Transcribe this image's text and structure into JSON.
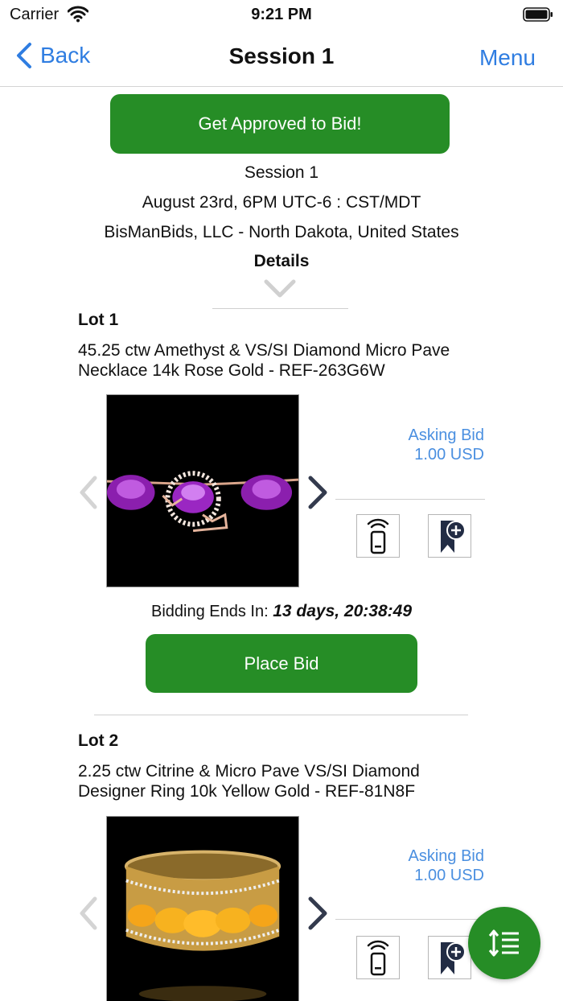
{
  "status_bar": {
    "carrier": "Carrier",
    "time": "9:21 PM"
  },
  "nav": {
    "back_label": "Back",
    "title": "Session 1",
    "menu_label": "Menu"
  },
  "approve_button": "Get Approved to Bid!",
  "session": {
    "name": "Session 1",
    "date": "August 23rd, 6PM UTC-6 : CST/MDT",
    "location": "BisManBids, LLC - North Dakota, United States",
    "details_label": "Details"
  },
  "lots": [
    {
      "title": "Lot 1",
      "description_line1": "45.25 ctw Amethyst & VS/SI Diamond Micro Pave",
      "description_line2": "Necklace 14k Rose Gold - REF-263G6W",
      "asking_label": "Asking Bid",
      "asking_value": "1.00 USD",
      "ends_label": "Bidding Ends In:",
      "ends_value": "13 days, 20:38:49",
      "place_bid_label": "Place Bid"
    },
    {
      "title": "Lot 2",
      "description_line1": "2.25 ctw Citrine & Micro Pave VS/SI Diamond",
      "description_line2": "Designer Ring 10k Yellow Gold - REF-81N8F",
      "asking_label": "Asking Bid",
      "asking_value": "1.00 USD"
    }
  ],
  "colors": {
    "accent": "#2f7de1",
    "green": "#268d26",
    "asking": "#4a8fe0"
  },
  "icons": [
    "wifi-icon",
    "battery-icon",
    "chevron-left-icon",
    "chevron-down-icon",
    "remote-bid-icon",
    "bookmark-add-icon",
    "sort-icon"
  ]
}
